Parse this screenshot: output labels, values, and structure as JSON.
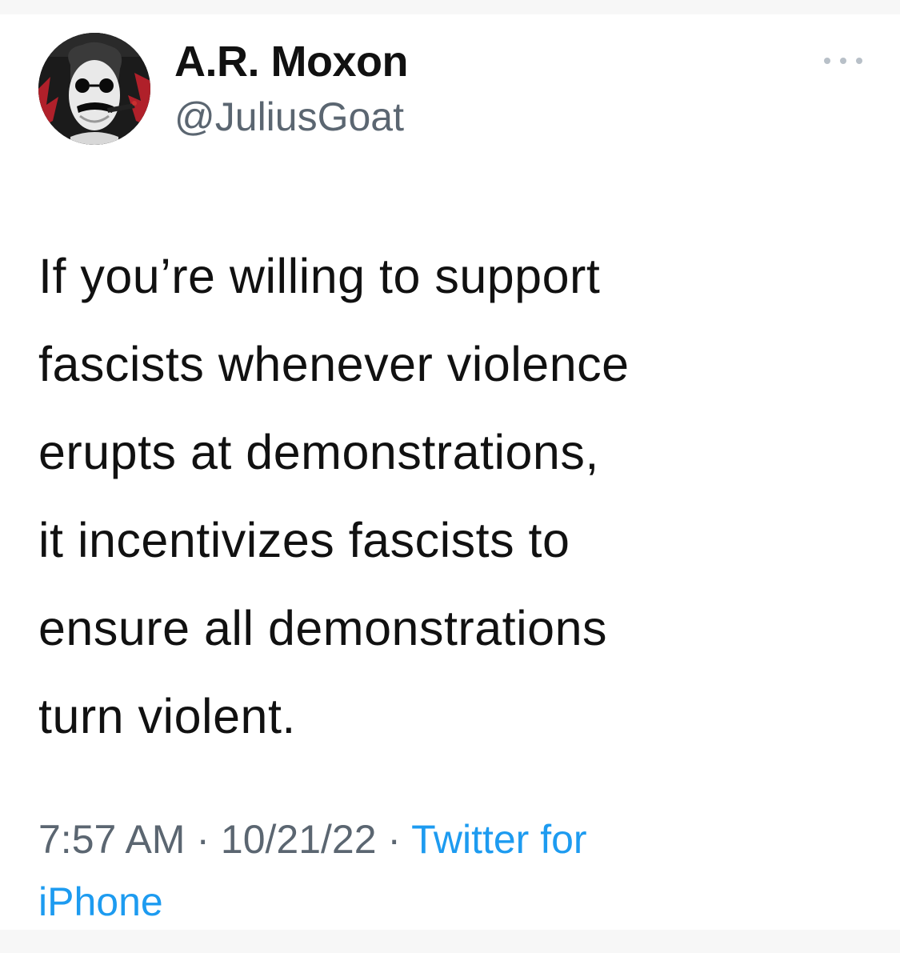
{
  "tweet": {
    "display_name": "A.R. Moxon",
    "handle": "@JuliusGoat",
    "text": "If you’re willing to support\nfascists whenever violence\nerupts at demonstrations,\nit incentivizes fascists to\nensure all demonstrations\nturn violent.",
    "time": "7:57 AM",
    "separator": " · ",
    "date": "10/21/22",
    "source_line1": "Twitter for",
    "source_line2": "iPhone"
  },
  "icons": {
    "more": "more-horizontal-icon",
    "avatar": "profile-avatar"
  },
  "colors": {
    "text": "#111111",
    "secondary": "#5b6671",
    "link": "#1d9bf0"
  }
}
